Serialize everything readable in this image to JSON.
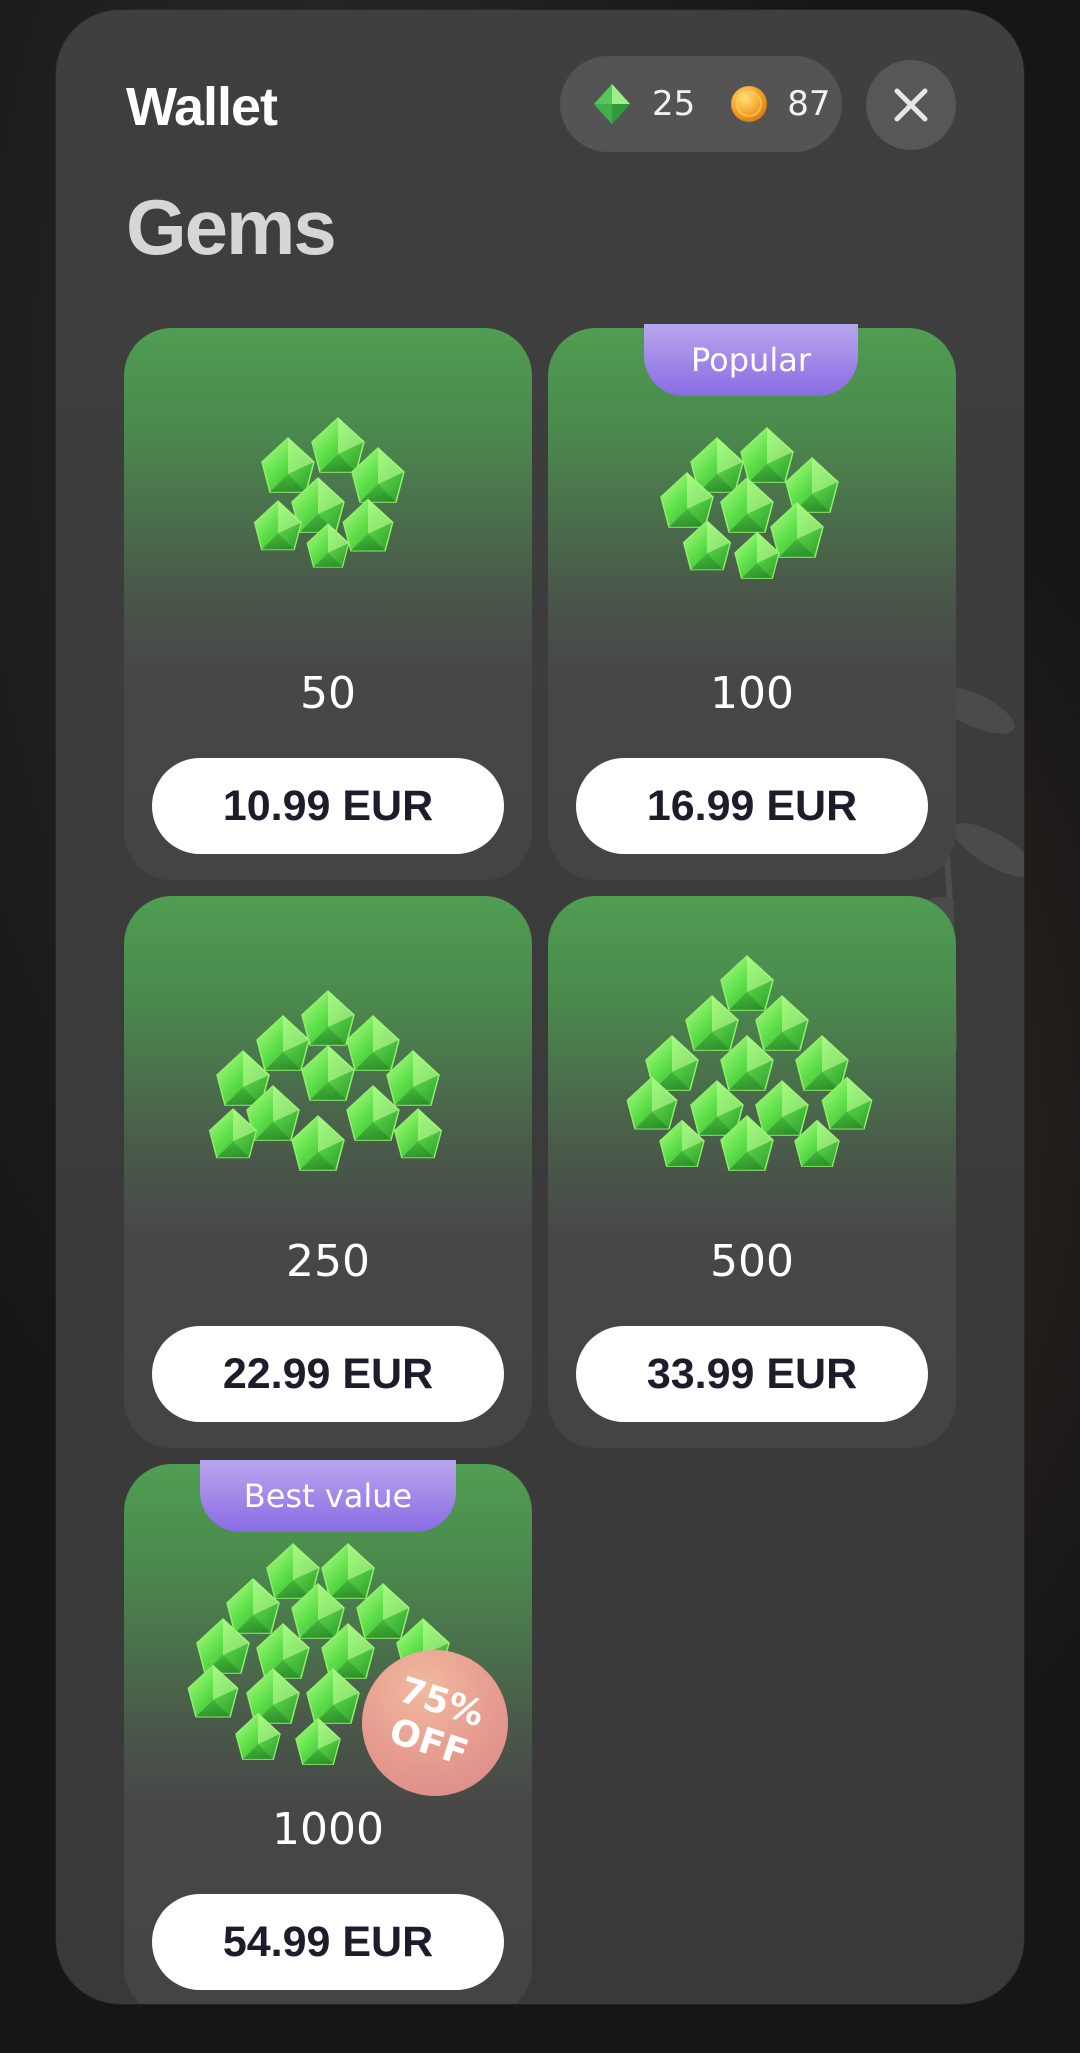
{
  "header": {
    "title": "Wallet",
    "balance": {
      "gems": "25",
      "coins": "87"
    },
    "close_icon": "close-icon"
  },
  "section": {
    "title": "Gems"
  },
  "colors": {
    "card_top": "#4f9d52",
    "tag": "#8a6ce3",
    "discount": "#e59a8e",
    "price_bg": "#ffffff"
  },
  "packs": [
    {
      "amount": "50",
      "price": "10.99 EUR"
    },
    {
      "amount": "100",
      "price": "16.99 EUR",
      "tag": "Popular"
    },
    {
      "amount": "250",
      "price": "22.99 EUR"
    },
    {
      "amount": "500",
      "price": "33.99 EUR"
    },
    {
      "amount": "1000",
      "price": "54.99 EUR",
      "tag": "Best value",
      "discount": [
        "75%",
        "OFF"
      ]
    }
  ]
}
